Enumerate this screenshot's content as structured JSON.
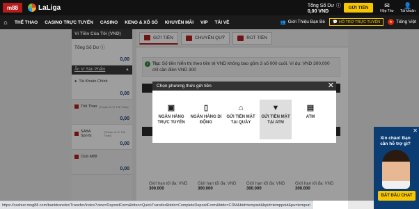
{
  "header": {
    "logo_text": "m88",
    "laliga_text": "LaLiga",
    "balance_label": "Tổng Số Dư",
    "balance_value": "0,00 VND",
    "deposit_label": "GỬI TIỀN",
    "mail_label": "Hộp Thư",
    "account_label": "Tài khoản"
  },
  "nav": {
    "items": [
      "THỂ THAO",
      "CASINO TRỰC TUYẾN",
      "CASINO",
      "KENO & XỔ SỐ",
      "KHUYẾN MÃI",
      "VIP",
      "TẢI VỀ"
    ],
    "refer": "Giới Thiệu Bạn Bè",
    "support": "HỖ TRỢ TRỰC TUYẾN",
    "language": "Tiếng Việt"
  },
  "sidebar": {
    "title": "Ví Tiền Của Tôi",
    "currency": "(VND)",
    "total_label": "Tổng Số Dư",
    "total_value": "0,00",
    "sub_title": "Ẩn Ví Sản Phẩm",
    "wallets": [
      {
        "name": "Tài Khoản Chính",
        "sub": "",
        "value": "0,00"
      },
      {
        "name": "Thể Thao",
        "sub": "(Thuộc về Ví Thể Thao)",
        "value": "0,00"
      },
      {
        "name": "SABA Sports",
        "sub": "(Thuộc về Ví Thể Thao)",
        "value": "0,00"
      },
      {
        "name": "Club M88",
        "sub": "",
        "value": "0,00"
      }
    ]
  },
  "tabs": [
    "GỬI TIỀN",
    "CHUYỂN QUỸ",
    "RÚT TIỀN"
  ],
  "tip": {
    "label": "Tip:",
    "text": "Số tiền hiển thị theo tiền tệ VND không bao gồm 3 số 000 cuối. Ví dụ: VND 300,000 chỉ cần điền VND 300"
  },
  "amounts": [
    {
      "label": "Giới hạn tối đa: VND",
      "value": "300.000"
    },
    {
      "label": "Giới hạn tối đa: VND",
      "value": "300.000"
    },
    {
      "label": "Giới hạn tối đa: VND",
      "value": "300.000"
    },
    {
      "label": "Giới hạn tối đa: VND",
      "value": "300.000"
    }
  ],
  "modal": {
    "title": "Chọn phương thức gửi tiền",
    "methods": [
      {
        "label": "NGÂN HÀNG TRỰC TUYẾN",
        "icon": "bank-card-icon"
      },
      {
        "label": "NGÂN HÀNG DI ĐỘNG",
        "icon": "mobile-phone-icon"
      },
      {
        "label": "GỬI TIỀN MẶT TẠI QUẦY",
        "icon": "bank-building-icon"
      },
      {
        "label": "GỬI TIỀN MẶT TẠI ATM",
        "icon": "cash-atm-icon"
      },
      {
        "label": "ATM",
        "icon": "atm-icon"
      }
    ]
  },
  "status_url": "https://cashier.mog88.com/banktransfer/Transfer/Index?view=DepositForm&btteo=QuickTransfer&btdo=CompleteDepositForm&btdo=CDM&bid=tempsid&bpid=temppoid&pu=tempurl",
  "chat": {
    "greeting": "Xin chào! Bạn cần hỗ trợ gì?",
    "button": "BẮT ĐẦU CHAT"
  }
}
